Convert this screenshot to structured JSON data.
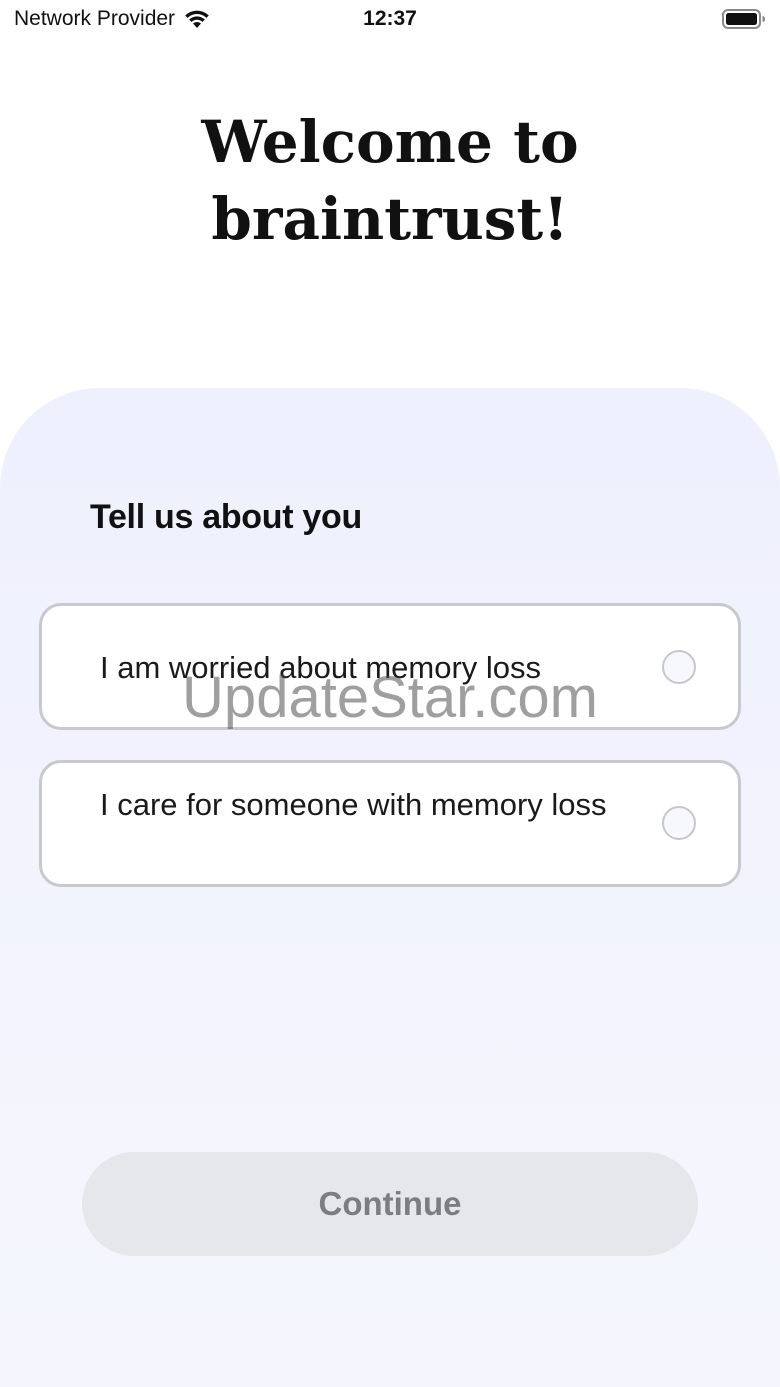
{
  "status_bar": {
    "carrier": "Network Provider",
    "time": "12:37",
    "wifi_icon": "wifi-icon",
    "battery_icon": "battery-icon"
  },
  "welcome": {
    "line1": "Welcome to",
    "line2": "braintrust!"
  },
  "section": {
    "heading": "Tell us about you"
  },
  "options": [
    {
      "label": "I am worried about memory loss",
      "selected": false
    },
    {
      "label": "I care for someone with memory loss",
      "selected": false
    }
  ],
  "watermark": "UpdateStar.com",
  "continue_button": {
    "label": "Continue",
    "enabled": false
  },
  "colors": {
    "panel_background": "#eef0fd",
    "button_disabled_bg": "#e6e7ea",
    "button_disabled_text": "#7c7d82",
    "option_border": "#c8c9cf"
  }
}
